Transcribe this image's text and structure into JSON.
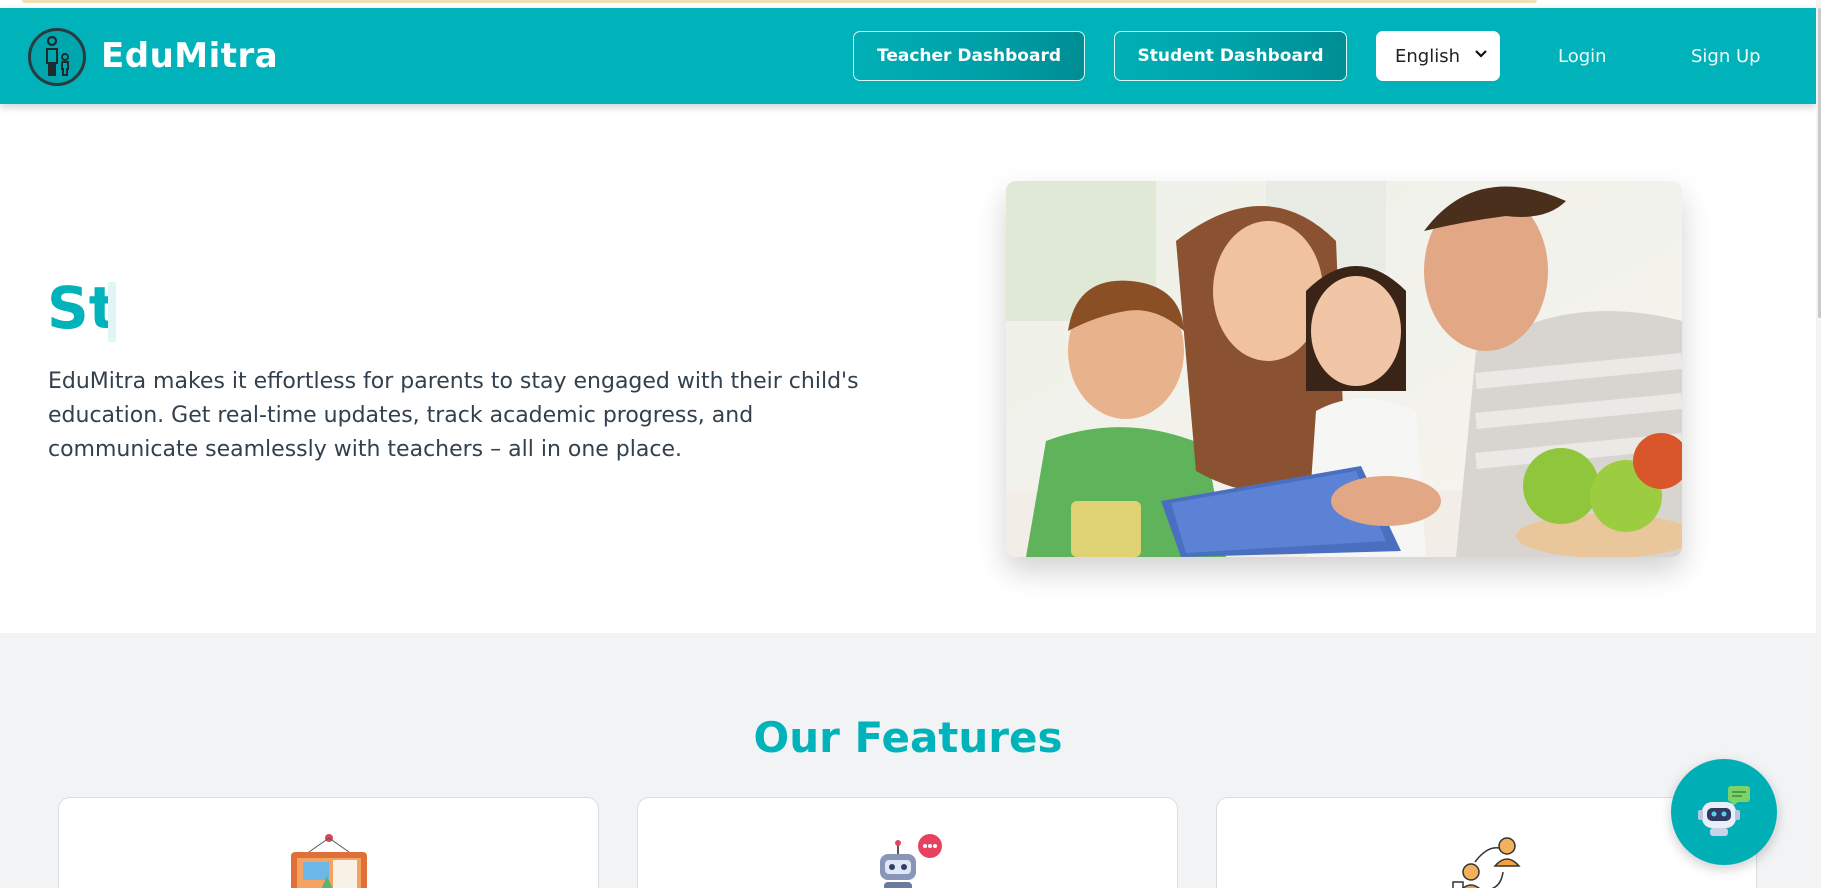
{
  "header": {
    "brand": "EduMitra",
    "teacher_dashboard": "Teacher Dashboard",
    "student_dashboard": "Student Dashboard",
    "language": "English",
    "login": "Login",
    "signup": "Sign Up"
  },
  "hero": {
    "title": "St",
    "description": "EduMitra makes it effortless for parents to stay engaged with their child's education. Get real-time updates, track academic progress, and communicate seamlessly with teachers – all in one place."
  },
  "features": {
    "title": "Our Features"
  },
  "colors": {
    "accent": "#00b2b9",
    "section_bg": "#f2f3f5"
  },
  "icons": [
    "parent-child-logo-icon",
    "chevron-down-icon",
    "notice-board-icon",
    "robot-chat-icon",
    "people-connect-icon",
    "chatbot-icon"
  ]
}
